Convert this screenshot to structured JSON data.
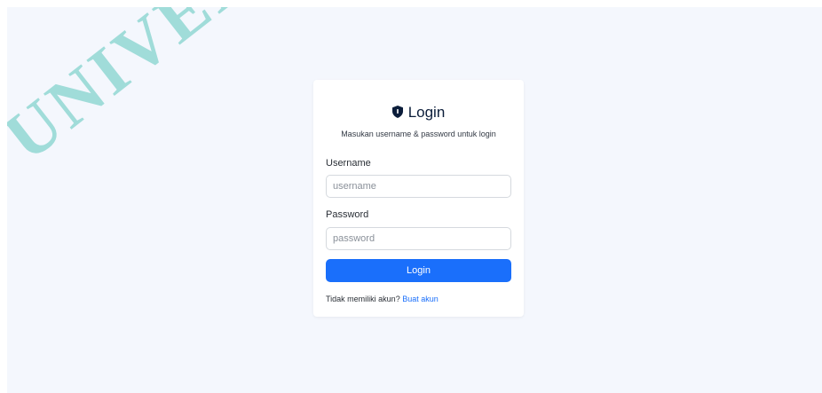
{
  "watermark": {
    "text": "UNIVERSITAS YOU"
  },
  "login": {
    "title": "Login",
    "title_icon": "shield-icon",
    "subtitle": "Masukan username & password untuk login",
    "username_label": "Username",
    "username_placeholder": "username",
    "username_value": "",
    "password_label": "Password",
    "password_placeholder": "password",
    "password_value": "",
    "button_label": "Login",
    "footer_text": "Tidak memiliki akun?",
    "footer_link": "Buat akun"
  },
  "colors": {
    "page_background": "#f4f7fd",
    "accent": "#1a6ffb",
    "title_text": "#0b1d3a",
    "watermark": "#2fb7a9"
  }
}
